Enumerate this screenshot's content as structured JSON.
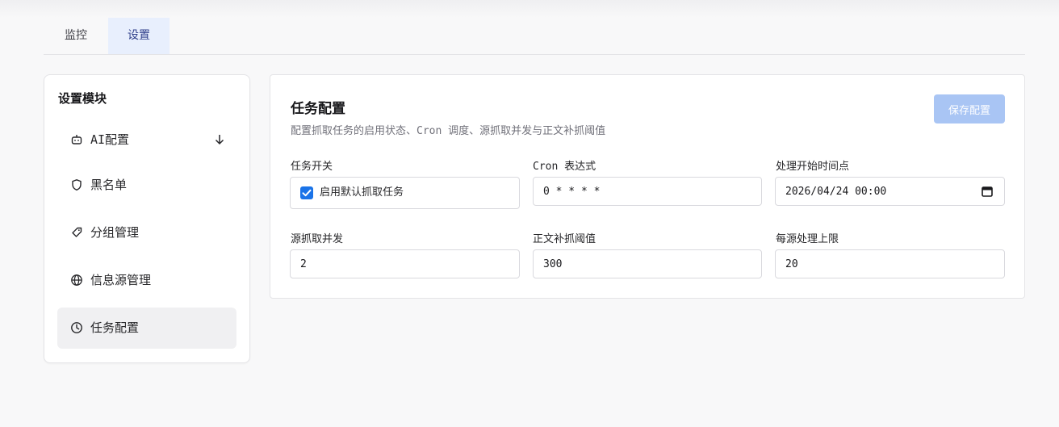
{
  "tabs": [
    {
      "label": "监控",
      "active": false
    },
    {
      "label": "设置",
      "active": true
    }
  ],
  "sidebar": {
    "title": "设置模块",
    "items": [
      {
        "label": "AI配置",
        "icon": "robot-icon",
        "expandable": true
      },
      {
        "label": "黑名单",
        "icon": "shield-icon"
      },
      {
        "label": "分组管理",
        "icon": "tag-icon"
      },
      {
        "label": "信息源管理",
        "icon": "globe-icon"
      },
      {
        "label": "任务配置",
        "icon": "clock-icon",
        "active": true
      }
    ]
  },
  "main": {
    "title": "任务配置",
    "subtitle": "配置抓取任务的启用状态、Cron 调度、源抓取并发与正文补抓阈值",
    "save_label": "保存配置",
    "fields": {
      "task_switch": {
        "label": "任务开关",
        "checkbox_label": "启用默认抓取任务",
        "checked": true
      },
      "cron": {
        "label": "Cron 表达式",
        "value": "0 * * * *"
      },
      "start_time": {
        "label": "处理开始时间点",
        "value": "2026/04/24 00:00"
      },
      "concurrency": {
        "label": "源抓取并发",
        "value": "2"
      },
      "refetch_threshold": {
        "label": "正文补抓阈值",
        "value": "300"
      },
      "per_source_limit": {
        "label": "每源处理上限",
        "value": "20"
      }
    }
  },
  "colors": {
    "accent": "#1a73e8",
    "active_tab_bg": "#e8effd",
    "save_button_disabled": "#a9c5f4"
  }
}
